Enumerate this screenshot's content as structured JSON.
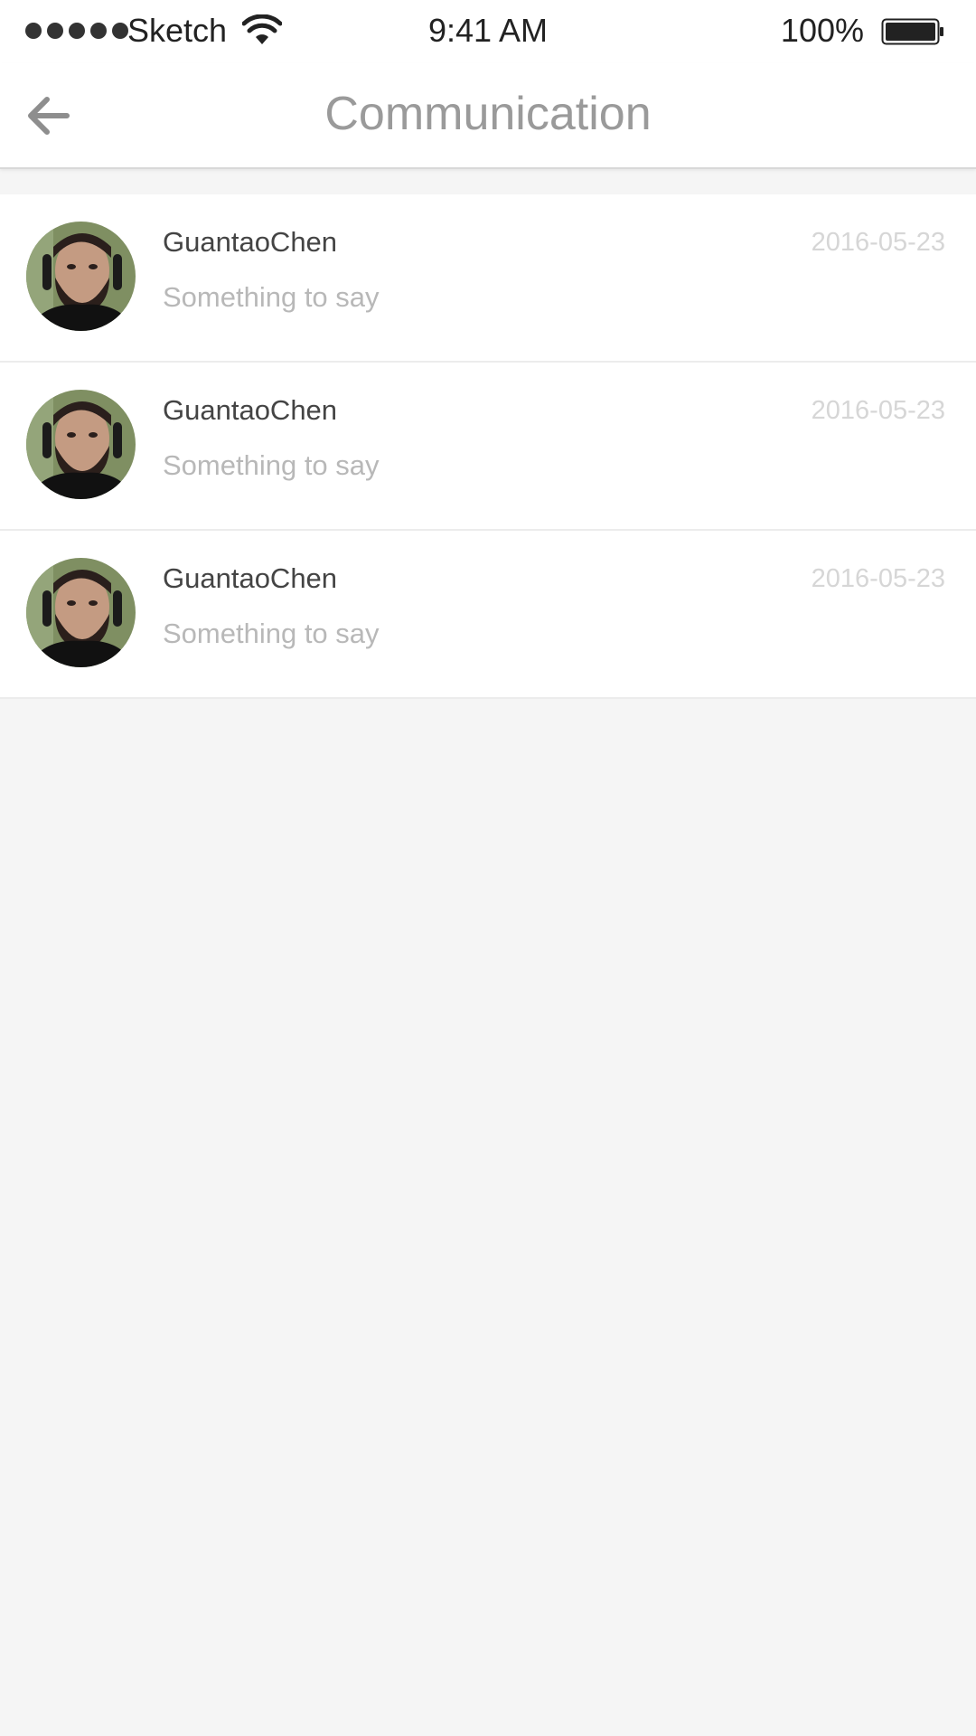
{
  "status_bar": {
    "signal_bars": 5,
    "carrier": "Sketch",
    "wifi_icon": "wifi-icon",
    "time": "9:41 AM",
    "battery_percent": "100%",
    "battery_level": 1.0,
    "battery_icon": "battery-icon"
  },
  "header": {
    "back_icon": "arrow-left-icon",
    "title": "Communication"
  },
  "conversations": [
    {
      "name": "GuantaoChen",
      "message": "Something to say",
      "date": "2016-05-23"
    },
    {
      "name": "GuantaoChen",
      "message": "Something to say",
      "date": "2016-05-23"
    },
    {
      "name": "GuantaoChen",
      "message": "Something to say",
      "date": "2016-05-23"
    }
  ],
  "colors": {
    "background": "#f5f5f5",
    "surface": "#ffffff",
    "title": "#9a9a9a",
    "name": "#444444",
    "preview": "#b8b8b8",
    "date": "#d6d6d6"
  }
}
